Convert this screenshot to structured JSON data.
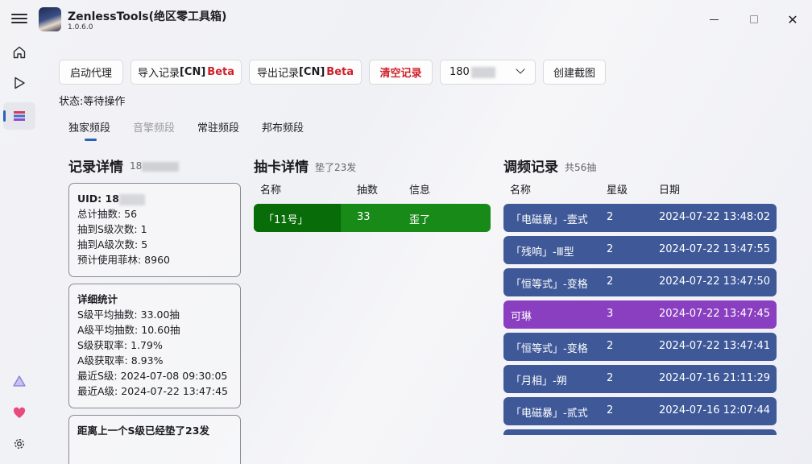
{
  "app": {
    "title": "ZenlessTools(绝区零工具箱)",
    "version": "1.0.6.0"
  },
  "window_controls": [
    "minimize",
    "maximize",
    "close"
  ],
  "nav": {
    "items": [
      {
        "icon": "home-icon",
        "active": false
      },
      {
        "icon": "play-icon",
        "active": false
      },
      {
        "icon": "signal-search-icon",
        "active": true
      }
    ],
    "footer_items": [
      {
        "icon": "triangle-icon"
      },
      {
        "icon": "heart-icon"
      },
      {
        "icon": "gear-icon"
      }
    ]
  },
  "toolbar": {
    "proxy_label": "启动代理",
    "import_label": "导入记录",
    "import_tag": "[CN]",
    "import_beta": "Beta",
    "export_label": "导出记录",
    "export_tag": "[CN]",
    "export_beta": "Beta",
    "clear_label": "清空记录",
    "uid_selected": "180",
    "screenshot_label": "创建截图"
  },
  "status": "状态:等待操作",
  "tabs": [
    {
      "label": "独家频段",
      "active": true
    },
    {
      "label": "音擎频段",
      "active": false
    },
    {
      "label": "常驻频段",
      "active": false
    },
    {
      "label": "邦布频段",
      "active": false
    }
  ],
  "record_details": {
    "title": "记录详情",
    "uid_prefix": "18",
    "summary": {
      "uid_label": "UID: 18",
      "lines": [
        "总计抽数: 56",
        "抽到S级次数: 1",
        "抽到A级次数: 5",
        "预计使用菲林: 8960"
      ]
    },
    "stats": {
      "heading": "详细统计",
      "lines": [
        "S级平均抽数: 33.00抽",
        "A级平均抽数: 10.60抽",
        "S级获取率: 1.79%",
        "A级获取率: 8.93%",
        "最近S级: 2024-07-08 09:30:05",
        "最近A级: 2024-07-22 13:47:45"
      ]
    },
    "pity_card": "距离上一个S级已经垫了23发"
  },
  "gacha_details": {
    "title": "抽卡详情",
    "subtitle": "垫了23发",
    "headers": [
      "名称",
      "抽数",
      "信息"
    ],
    "rows": [
      {
        "name": "「11号」",
        "count": "33",
        "info": "歪了",
        "color": "#178a17"
      }
    ]
  },
  "pull_history": {
    "title": "调频记录",
    "subtitle": "共56抽",
    "headers": [
      "名称",
      "星级",
      "日期"
    ],
    "rows": [
      {
        "name": "「电磁暴」-壹式",
        "star": "2",
        "date": "2024-07-22 13:48:02",
        "color": "#3e5898"
      },
      {
        "name": "「残响」-Ⅲ型",
        "star": "2",
        "date": "2024-07-22 13:47:55",
        "color": "#3e5898"
      },
      {
        "name": "「恒等式」-变格",
        "star": "2",
        "date": "2024-07-22 13:47:50",
        "color": "#3e5898"
      },
      {
        "name": "可琳",
        "star": "3",
        "date": "2024-07-22 13:47:45",
        "color": "#8a3fc0"
      },
      {
        "name": "「恒等式」-变格",
        "star": "2",
        "date": "2024-07-22 13:47:41",
        "color": "#3e5898"
      },
      {
        "name": "「月相」-朔",
        "star": "2",
        "date": "2024-07-16 21:11:29",
        "color": "#3e5898"
      },
      {
        "name": "「电磁暴」-贰式",
        "star": "2",
        "date": "2024-07-16 12:07:44",
        "color": "#3e5898"
      },
      {
        "name": "",
        "star": "",
        "date": "",
        "color": "#3e5898"
      }
    ]
  }
}
